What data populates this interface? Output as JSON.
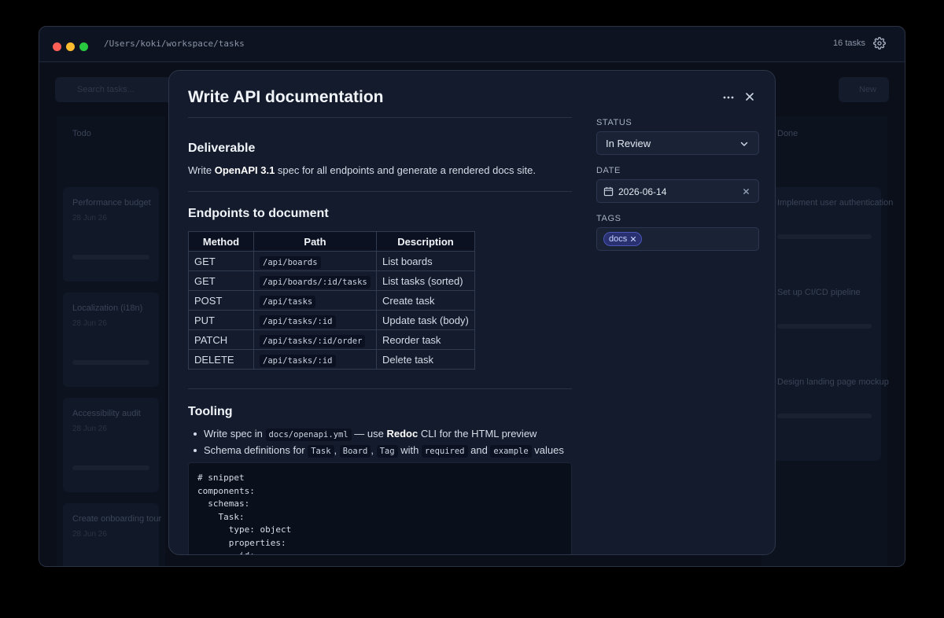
{
  "titlebar": {
    "path": "/Users/koki/workspace/tasks",
    "task_count": "16 tasks"
  },
  "background": {
    "search_placeholder": "Search tasks...",
    "new_button": "New",
    "columns": [
      {
        "title": "Todo",
        "cards": [
          {
            "title": "Performance budget",
            "sub": "28 Jun 26"
          },
          {
            "title": "Localization (i18n)",
            "sub": "28 Jun 26"
          },
          {
            "title": "Accessibility audit",
            "sub": "28 Jun 26"
          },
          {
            "title": "Create onboarding tour",
            "sub": "28 Jun 26"
          }
        ]
      },
      {
        "title": "Done",
        "cards": [
          {
            "title": "Implement user authentication",
            "sub": ""
          },
          {
            "title": "Set up CI/CD pipeline",
            "sub": ""
          },
          {
            "title": "Design landing page mockup",
            "sub": ""
          }
        ]
      }
    ]
  },
  "modal": {
    "title": "Write API documentation",
    "sections": {
      "deliverable": {
        "heading": "Deliverable",
        "text_prefix": "Write ",
        "text_bold": "OpenAPI 3.1",
        "text_suffix": " spec for all endpoints and generate a rendered docs site."
      },
      "endpoints": {
        "heading": "Endpoints to document",
        "columns": [
          "Method",
          "Path",
          "Description"
        ],
        "rows": [
          {
            "method": "GET",
            "path": "/api/boards",
            "description": "List boards"
          },
          {
            "method": "GET",
            "path": "/api/boards/:id/tasks",
            "description": "List tasks (sorted)"
          },
          {
            "method": "POST",
            "path": "/api/tasks",
            "description": "Create task"
          },
          {
            "method": "PUT",
            "path": "/api/tasks/:id",
            "description": "Update task (body)"
          },
          {
            "method": "PATCH",
            "path": "/api/tasks/:id/order",
            "description": "Reorder task"
          },
          {
            "method": "DELETE",
            "path": "/api/tasks/:id",
            "description": "Delete task"
          }
        ]
      },
      "tooling": {
        "heading": "Tooling",
        "bullet1": {
          "t1": "Write spec in ",
          "c1": "docs/openapi.yml",
          "t2": " — use ",
          "b1": "Redoc",
          "t3": " CLI for the HTML preview"
        },
        "bullet2": {
          "t1": "Schema definitions for ",
          "c1": "Task",
          "t2": ", ",
          "c2": "Board",
          "t3": ", ",
          "c3": "Tag",
          "t4": " with ",
          "c4": "required",
          "t5": " and ",
          "c5": "example",
          "t6": " values"
        },
        "code": "# snippet\ncomponents:\n  schemas:\n    Task:\n      type: object\n      properties:\n        id:"
      }
    },
    "sidebar": {
      "status_label": "STATUS",
      "status_value": "In Review",
      "date_label": "DATE",
      "date_value": "2026-06-14",
      "tags_label": "TAGS",
      "tags": [
        "docs"
      ]
    }
  },
  "colors": {
    "window_bg": "#0d1320",
    "modal_bg": "#131b2c",
    "tag_bg": "#2a3170",
    "tag_text": "#c7d2fe"
  }
}
